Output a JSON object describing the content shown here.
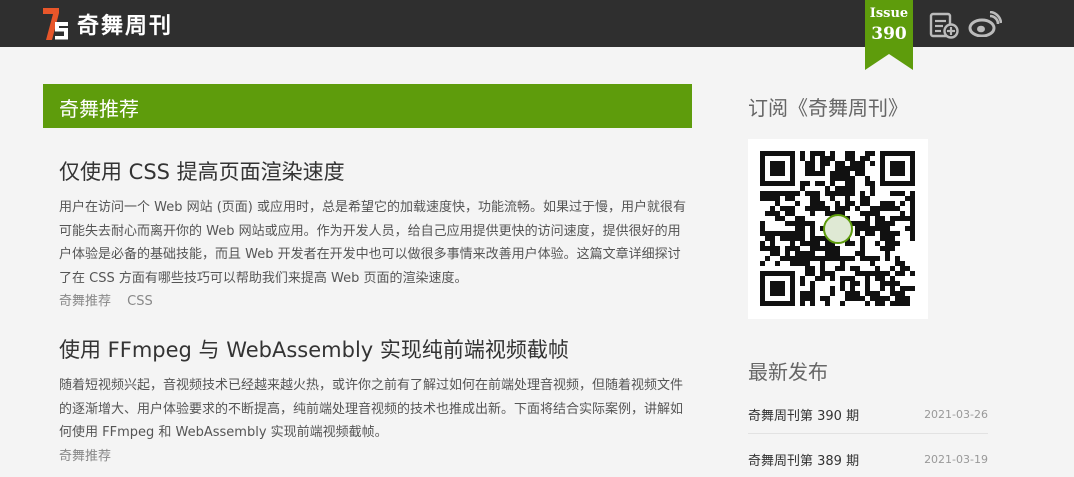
{
  "header": {
    "site_name": "奇舞周刊",
    "logo_mark": "75",
    "issue_label": "Issue",
    "issue_number": "390",
    "colors": {
      "bar": "#2f2f2f",
      "badge": "#5e9c0c",
      "logo_accent": "#e8562a"
    },
    "icons": [
      "rss-icon",
      "weibo-icon"
    ]
  },
  "main": {
    "section_title": "奇舞推荐",
    "articles": [
      {
        "title": "仅使用 CSS 提高页面渲染速度",
        "summary": "用户在访问一个 Web 网站 (页面) 或应用时，总是希望它的加载速度快，功能流畅。如果过于慢，用户就很有可能失去耐心而离开你的 Web 网站或应用。作为开发人员，给自己应用提供更快的访问速度，提供很好的用户体验是必备的基础技能，而且 Web 开发者在开发中也可以做很多事情来改善用户体验。这篇文章详细探讨了在 CSS 方面有哪些技巧可以帮助我们来提高 Web 页面的渲染速度。",
        "tags": [
          "奇舞推荐",
          "CSS"
        ]
      },
      {
        "title": "使用 FFmpeg 与 WebAssembly 实现纯前端视频截帧",
        "summary": "随着短视频兴起，音视频技术已经越来越火热，或许你之前有了解过如何在前端处理音视频，但随着视频文件的逐渐增大、用户体验要求的不断提高，纯前端处理音视频的技术也推成出新。下面将结合实际案例，讲解如何使用 FFmpeg 和 WebAssembly 实现前端视频截帧。",
        "tags": [
          "奇舞推荐"
        ]
      }
    ]
  },
  "sidebar": {
    "subscribe_title": "订阅《奇舞周刊》",
    "qr_alt": "qr-code",
    "latest_title": "最新发布",
    "latest": [
      {
        "name": "奇舞周刊第 390 期",
        "date": "2021-03-26"
      },
      {
        "name": "奇舞周刊第 389 期",
        "date": "2021-03-19"
      }
    ]
  }
}
